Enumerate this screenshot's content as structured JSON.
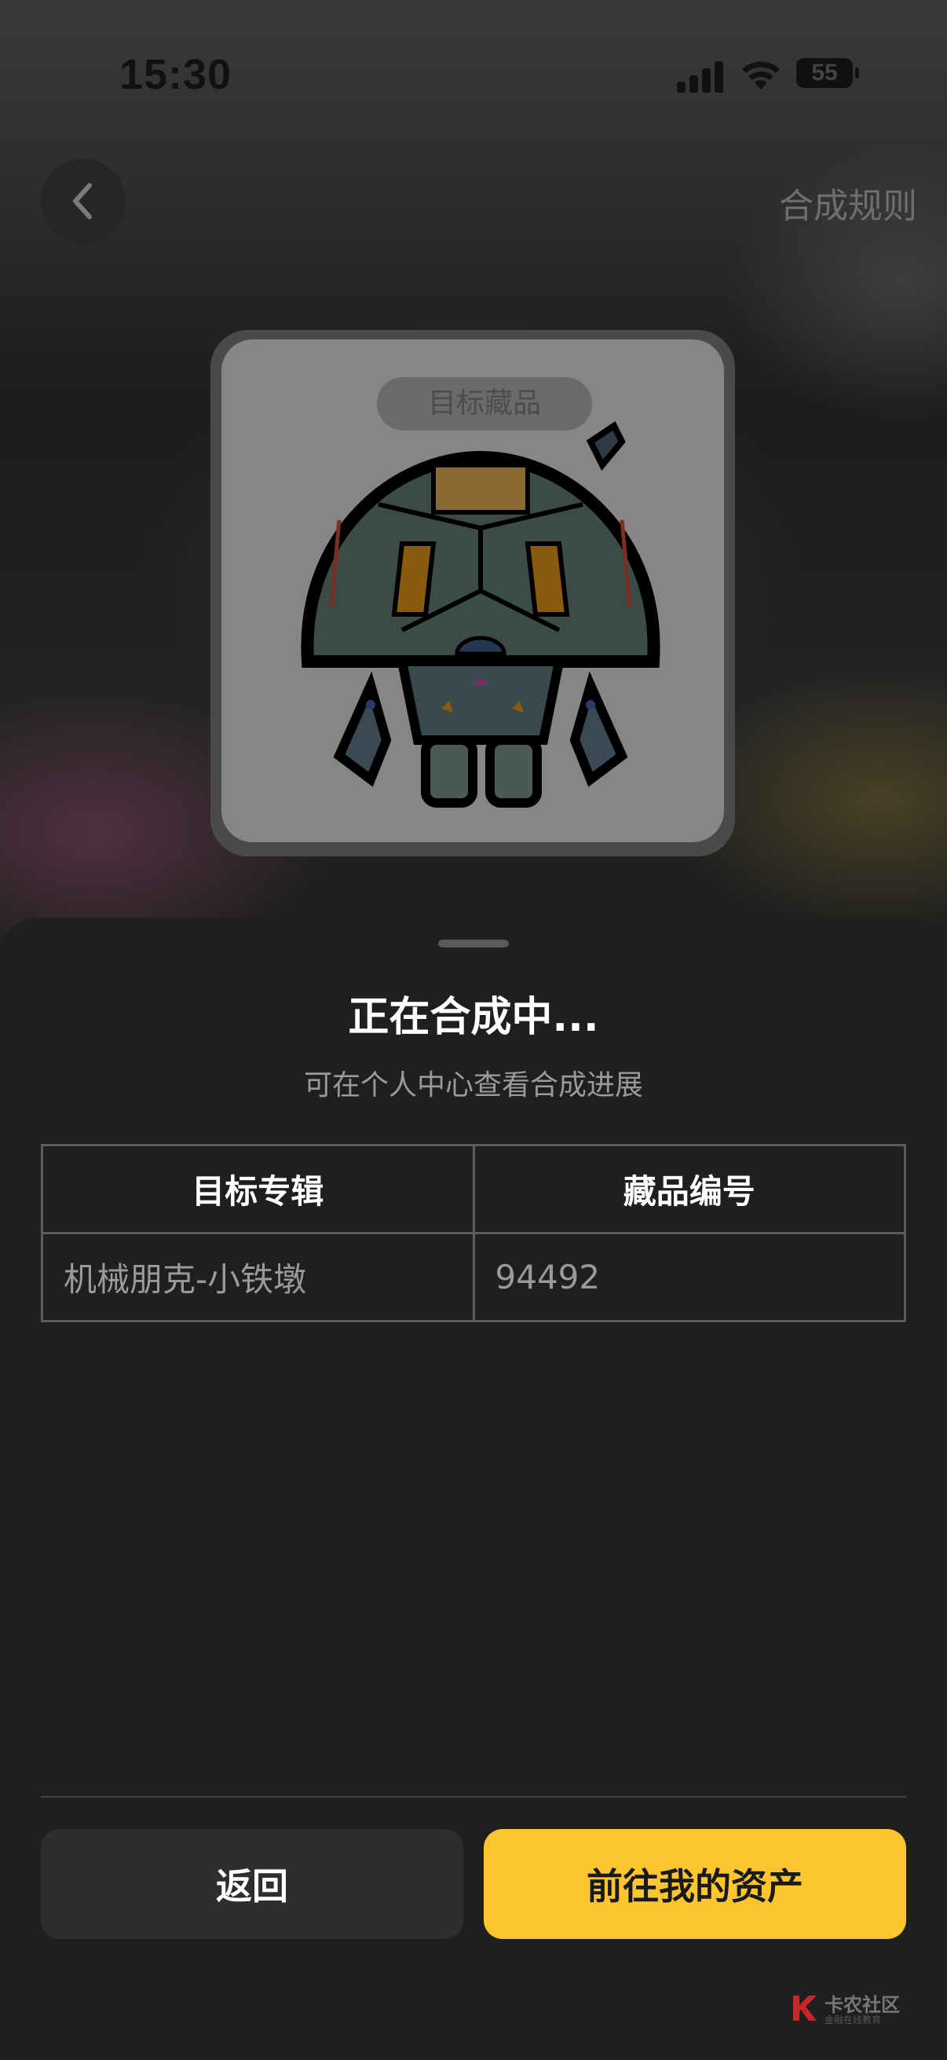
{
  "status_bar": {
    "time": "15:30",
    "battery": "55"
  },
  "header": {
    "back_icon": "chevron-left-icon",
    "rules_link": "合成规则"
  },
  "card": {
    "tag": "目标藏品",
    "image": "robot-collectible-illustration"
  },
  "sheet": {
    "title": "正在合成中...",
    "subtitle": "可在个人中心查看合成进展",
    "table": {
      "headers": [
        "目标专辑",
        "藏品编号"
      ],
      "rows": [
        [
          "机械朋克-小铁墩",
          "94492"
        ]
      ]
    },
    "buttons": {
      "back": "返回",
      "assets": "前往我的资产"
    }
  },
  "watermark": {
    "text": "卡农社区",
    "sub": "金融在线教育"
  },
  "colors": {
    "accent": "#fec62e",
    "sheet_bg": "#1f1f1f"
  }
}
